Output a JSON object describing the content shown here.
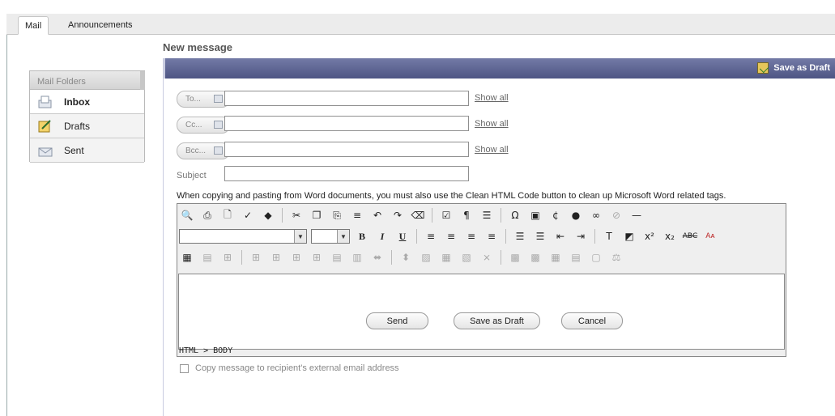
{
  "tabs": [
    {
      "label": "Mail"
    },
    {
      "label": "Announcements"
    }
  ],
  "page_title": "New message",
  "folders": {
    "header": "Mail Folders",
    "items": [
      {
        "label": "Inbox"
      },
      {
        "label": "Drafts"
      },
      {
        "label": "Sent"
      }
    ]
  },
  "header_bar": {
    "save_draft_label": "Save as Draft"
  },
  "fields": {
    "to": {
      "button": "To...",
      "value": "",
      "show_all": "Show all"
    },
    "cc": {
      "button": "Cc...",
      "value": "",
      "show_all": "Show all"
    },
    "bcc": {
      "button": "Bcc...",
      "value": "",
      "show_all": "Show all"
    },
    "subject": {
      "label": "Subject",
      "value": ""
    }
  },
  "warning": "When copying and pasting from Word documents, you must also use the Clean HTML Code button to clean up Microsoft Word related tags.",
  "editor": {
    "font_select": "",
    "size_select": "",
    "path": "HTML > BODY",
    "body": ""
  },
  "copy_external": {
    "label": "Copy message to recipient's external email address",
    "checked": false
  },
  "actions": {
    "send": "Send",
    "save_draft": "Save as Draft",
    "cancel": "Cancel"
  },
  "colors": {
    "header_bar": "#5a6190",
    "active_tab": "#ffffff"
  }
}
